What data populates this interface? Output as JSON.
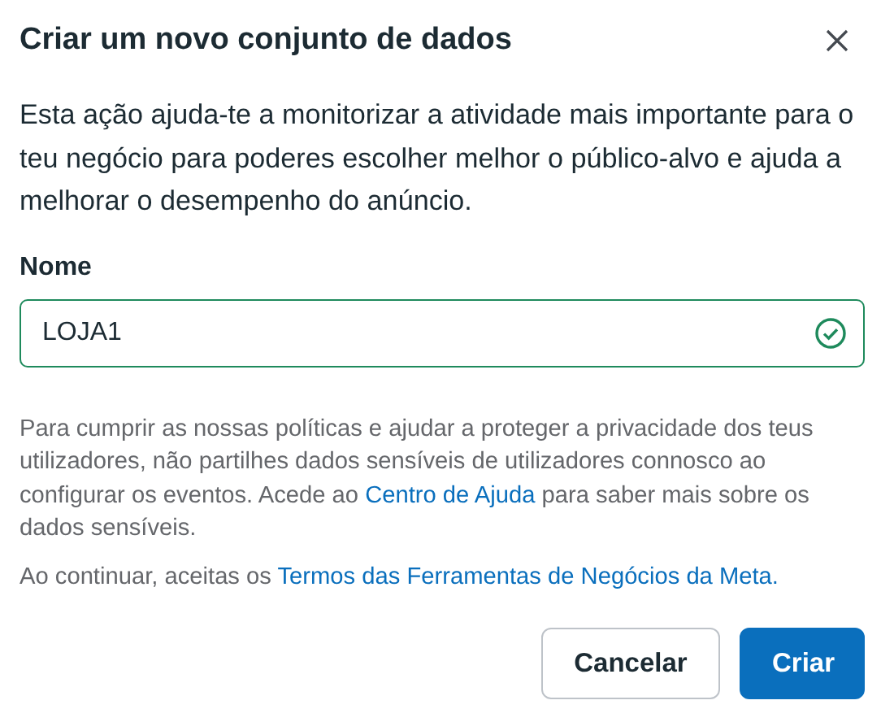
{
  "dialog": {
    "title": "Criar um novo conjunto de dados"
  },
  "description": "Esta ação ajuda-te a monitorizar a atividade mais importante para o teu negócio para poderes escolher melhor o público-alvo e ajuda a melhorar o desempenho do anúncio.",
  "name_field": {
    "label": "Nome",
    "value": "LOJA1",
    "valid": true
  },
  "notices": [
    {
      "before": "Para cumprir as nossas políticas e ajudar a proteger a privacidade dos teus utilizadores, não partilhes dados sensíveis de utilizadores connosco ao configurar os eventos. Acede ao ",
      "link": "Centro de Ajuda",
      "after": " para saber mais sobre os dados sensíveis."
    },
    {
      "before": "Ao continuar, aceitas os ",
      "link": "Termos das Ferramentas de Negócios da Meta."
    }
  ],
  "buttons": [
    {
      "label": "Cancelar",
      "kind": "secondary"
    },
    {
      "label": "Criar",
      "kind": "primary"
    }
  ]
}
